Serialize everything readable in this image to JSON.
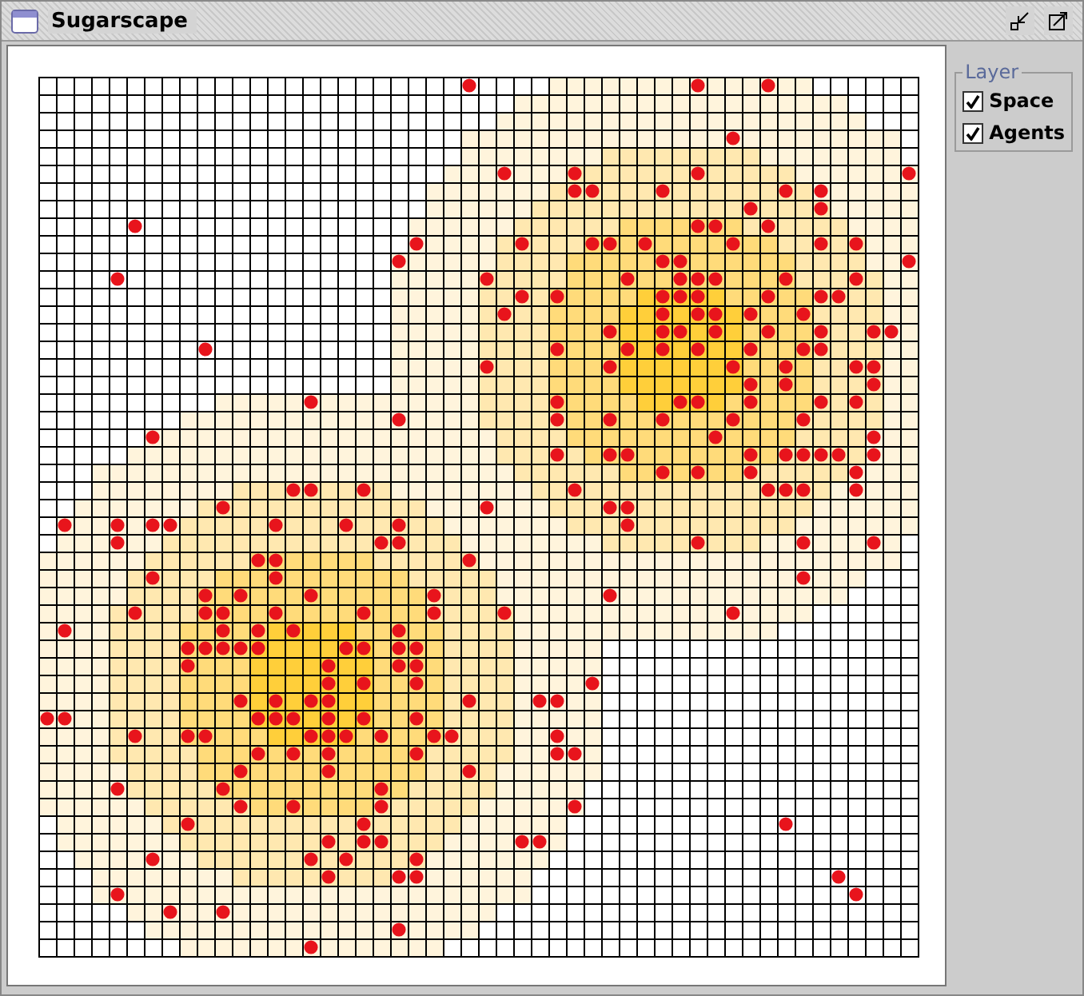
{
  "window": {
    "title": "Sugarscape"
  },
  "layers": {
    "title": "Layer",
    "items": [
      {
        "label": "Space",
        "checked": true
      },
      {
        "label": "Agents",
        "checked": true
      }
    ]
  }
}
